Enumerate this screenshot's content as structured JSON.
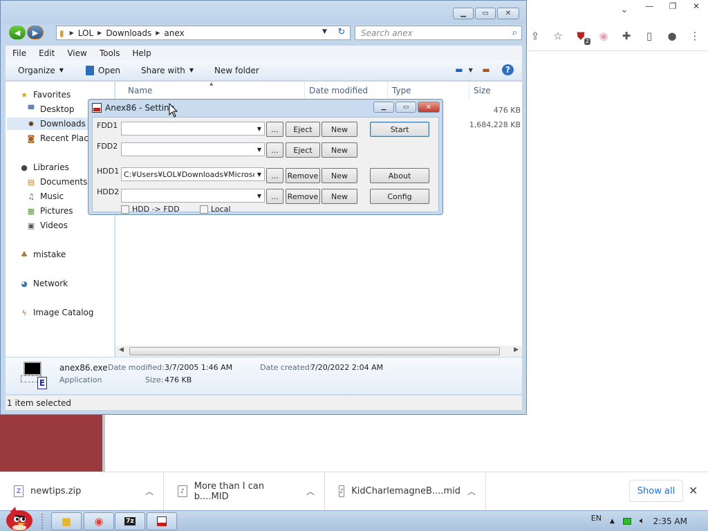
{
  "explorer": {
    "breadcrumb": [
      "LOL",
      "Downloads",
      "anex"
    ],
    "search_placeholder": "Search anex",
    "menu": [
      "File",
      "Edit",
      "View",
      "Tools",
      "Help"
    ],
    "commands": {
      "organize": "Organize",
      "open": "Open",
      "share_with": "Share with",
      "new_folder": "New folder"
    },
    "nav": {
      "favorites": "Favorites",
      "desktop": "Desktop",
      "downloads": "Downloads",
      "recent": "Recent Places",
      "libraries": "Libraries",
      "documents": "Documents",
      "music": "Music",
      "pictures": "Pictures",
      "videos": "Videos",
      "mistake": "mistake",
      "network": "Network",
      "image_catalog": "Image Catalog"
    },
    "columns": {
      "name": "Name",
      "date_modified": "Date modified",
      "type": "Type",
      "size": "Size"
    },
    "rows": [
      {
        "size": "476 KB"
      },
      {
        "size": "1,684,228 KB"
      }
    ],
    "details": {
      "filename": "anex86.exe",
      "type": "Application",
      "date_modified_label": "Date modified:",
      "date_modified": "3/7/2005 1:46 AM",
      "size_label": "Size:",
      "size": "476 KB",
      "date_created_label": "Date created:",
      "date_created": "7/20/2022 2:04 AM"
    },
    "status": "1 item selected"
  },
  "dialog": {
    "title": "Anex86 - Setting",
    "fdd1_label": "FDD1",
    "fdd2_label": "FDD2",
    "hdd1_label": "HDD1",
    "hdd2_label": "HDD2",
    "hdd1_value": "C:¥Users¥LOL¥Downloads¥Microsoft",
    "browse": "...",
    "eject": "Eject",
    "remove": "Remove",
    "new": "New",
    "start": "Start",
    "about": "About",
    "config": "Config",
    "hdd_fdd": "HDD -> FDD",
    "local": "Local"
  },
  "downloads": {
    "items": [
      "newtips.zip",
      "More than I can b....MID",
      "KidCharlemagneB....mid"
    ],
    "show_all": "Show all"
  },
  "taskbar": {
    "lang": "EN",
    "time": "2:35 AM"
  },
  "chrome": {
    "extension_badge": "2"
  }
}
